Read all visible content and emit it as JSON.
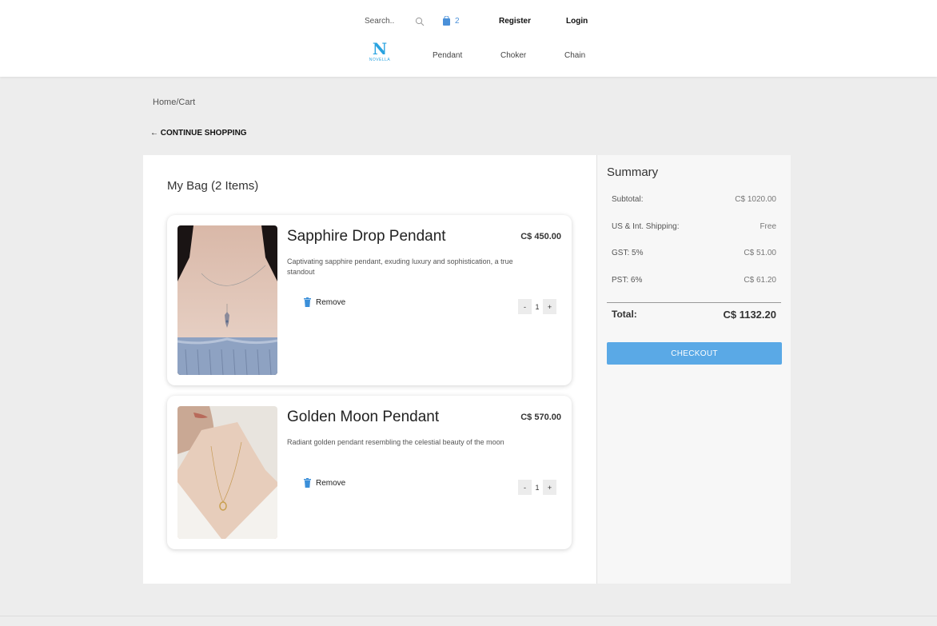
{
  "header": {
    "search_placeholder": "Search..",
    "cart_count": "2",
    "register_label": "Register",
    "login_label": "Login",
    "logo_text": "NOVELLA",
    "categories": [
      "Pendant",
      "Choker",
      "Chain"
    ],
    "accent_color": "#5aa9e6"
  },
  "breadcrumb": "Home/Cart",
  "continue_label": "← CONTINUE SHOPPING",
  "bag": {
    "title": "My Bag (2 Items)",
    "items": [
      {
        "name": "Sapphire Drop Pendant",
        "price": "C$ 450.00",
        "description": "Captivating sapphire pendant, exuding luxury and sophistication, a true standout",
        "remove_label": "Remove",
        "quantity": "1",
        "minus": "-",
        "plus": "+"
      },
      {
        "name": "Golden Moon Pendant",
        "price": "C$ 570.00",
        "description": "Radiant golden pendant resembling the celestial beauty of the moon",
        "remove_label": "Remove",
        "quantity": "1",
        "minus": "-",
        "plus": "+"
      }
    ]
  },
  "summary": {
    "title": "Summary",
    "rows": [
      {
        "label": "Subtotal:",
        "value": "C$ 1020.00"
      },
      {
        "label": "US & Int. Shipping:",
        "value": "Free"
      },
      {
        "label": "GST: 5%",
        "value": "C$ 51.00"
      },
      {
        "label": "PST: 6%",
        "value": "C$ 61.20"
      }
    ],
    "total_label": "Total:",
    "total_value": "C$ 1132.20",
    "checkout_label": "CHECKOUT"
  }
}
